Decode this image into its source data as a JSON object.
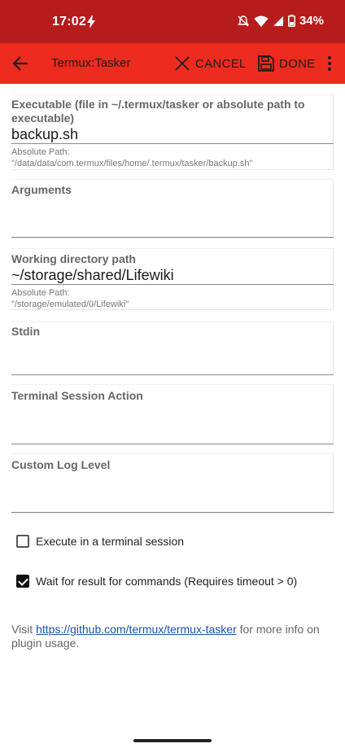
{
  "status_bar": {
    "time": "17:02",
    "battery": "34%"
  },
  "toolbar": {
    "title": "Termux:Tasker",
    "cancel_label": "CANCEL",
    "done_label": "DONE"
  },
  "form": {
    "executable": {
      "label": "Executable (file in ~/.termux/tasker or absolute path to executable)",
      "value": "backup.sh",
      "abs_label": "Absolute Path:",
      "abs_path": "\"/data/data/com.termux/files/home/.termux/tasker/backup.sh\""
    },
    "arguments": {
      "label": "Arguments",
      "value": ""
    },
    "working_dir": {
      "label": "Working directory path",
      "value": "~/storage/shared/Lifewiki",
      "abs_label": "Absolute Path:",
      "abs_path": "\"/storage/emulated/0/Lifewiki\""
    },
    "stdin": {
      "label": "Stdin",
      "value": ""
    },
    "terminal_session_action": {
      "label": "Terminal Session Action",
      "value": ""
    },
    "custom_log_level": {
      "label": "Custom Log Level",
      "value": ""
    }
  },
  "options": {
    "execute_in_terminal": {
      "label": "Execute in a terminal session",
      "checked": false
    },
    "wait_for_result": {
      "label": "Wait for result for commands (Requires timeout > 0)",
      "checked": true
    }
  },
  "info": {
    "prefix": "Visit ",
    "link": "https://github.com/termux/termux-tasker",
    "suffix": " for more info on plugin usage."
  },
  "colors": {
    "status_bar": "#b71c1c",
    "toolbar": "#ed2b1e",
    "link": "#1a4fb0"
  }
}
